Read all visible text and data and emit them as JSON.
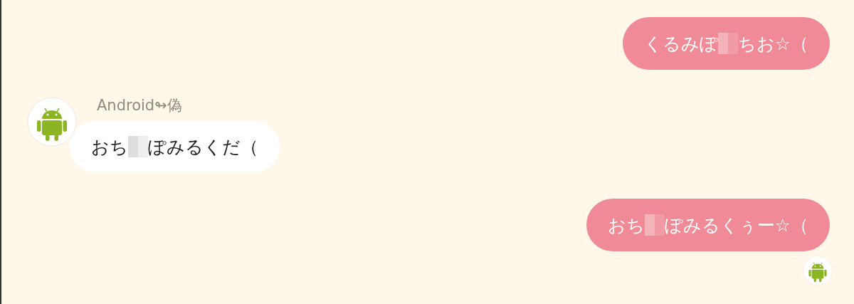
{
  "messages": [
    {
      "kind": "sent",
      "parts": [
        {
          "kind": "text",
          "text": "くるみぽ"
        },
        {
          "kind": "censored"
        },
        {
          "kind": "text",
          "text": "ちお☆（"
        }
      ]
    },
    {
      "kind": "received",
      "sender": "Android↬偽",
      "parts": [
        {
          "kind": "text",
          "text": "おち"
        },
        {
          "kind": "censored"
        },
        {
          "kind": "text",
          "text": "ぽみるくだ（"
        }
      ]
    },
    {
      "kind": "sent",
      "parts": [
        {
          "kind": "text",
          "text": "おち"
        },
        {
          "kind": "censored"
        },
        {
          "kind": "text",
          "text": "ぽみるくぅー☆（"
        }
      ],
      "read_by_avatar": true
    }
  ]
}
